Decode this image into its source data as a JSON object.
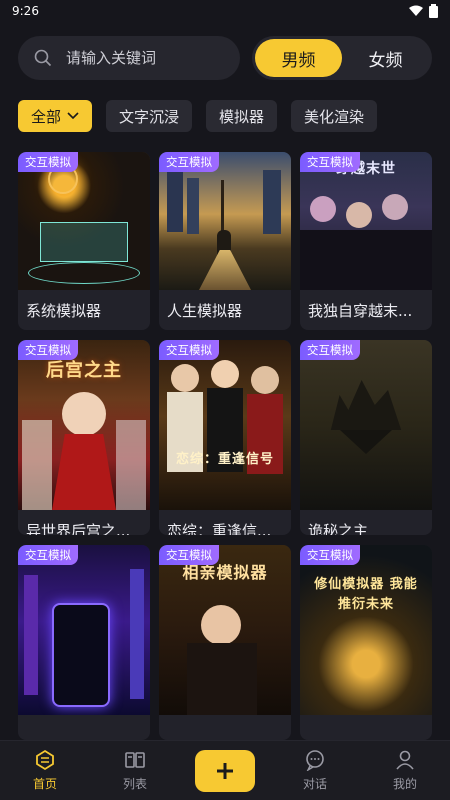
{
  "status": {
    "time": "9:26"
  },
  "search": {
    "placeholder": "请输入关键词"
  },
  "gender_tabs": [
    {
      "label": "男频",
      "active": true
    },
    {
      "label": "女频",
      "active": false
    }
  ],
  "filters": [
    {
      "label": "全部",
      "active": true
    },
    {
      "label": "文字沉浸",
      "active": false
    },
    {
      "label": "模拟器",
      "active": false
    },
    {
      "label": "美化渲染",
      "active": false
    }
  ],
  "badge_label": "交互模拟",
  "cards": [
    {
      "title": "系统模拟器",
      "art_text": ""
    },
    {
      "title": "人生模拟器",
      "art_text": ""
    },
    {
      "title": "我独自穿越末...",
      "art_text": "穿越末世"
    },
    {
      "title": "异世界后宫之...",
      "art_text": "后宫之主"
    },
    {
      "title": "恋综：重逢信...",
      "art_text": "恋综：重逢信号"
    },
    {
      "title": "诡秘之主",
      "art_text": ""
    },
    {
      "title": "",
      "art_text": ""
    },
    {
      "title": "",
      "art_text": "相亲模拟器"
    },
    {
      "title": "",
      "art_text": "修仙模拟器 我能推衍未来"
    }
  ],
  "tabbar": [
    {
      "label": "首页",
      "icon": "home-icon",
      "active": true
    },
    {
      "label": "列表",
      "icon": "book-icon",
      "active": false
    },
    {
      "label": "",
      "icon": "plus-icon",
      "active": false
    },
    {
      "label": "对话",
      "icon": "chat-icon",
      "active": false
    },
    {
      "label": "我的",
      "icon": "person-icon",
      "active": false
    }
  ],
  "colors": {
    "accent": "#f7c932",
    "badge": "#8a62ff",
    "background": "#16161c"
  }
}
